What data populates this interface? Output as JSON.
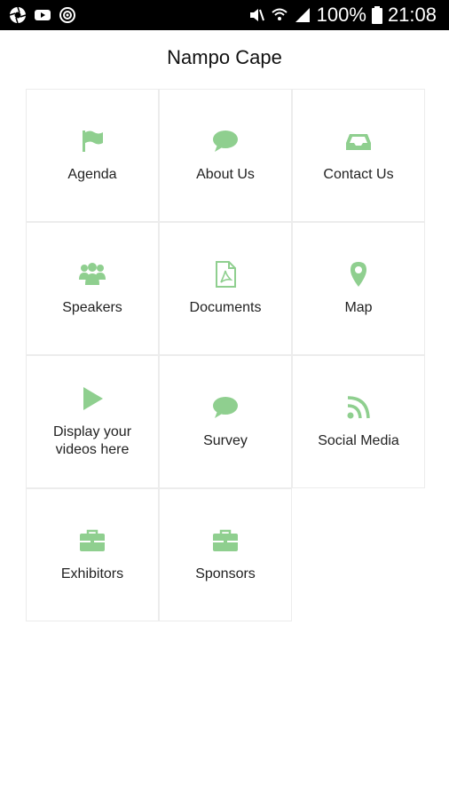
{
  "status_bar": {
    "battery": "100%",
    "time": "21:08",
    "left_icons": [
      "aperture-icon",
      "youtube-icon",
      "target-icon"
    ],
    "right_icons": [
      "mute-icon",
      "wifi-icon",
      "signal-icon",
      "battery-icon"
    ]
  },
  "header": {
    "title": "Nampo Cape"
  },
  "menu": {
    "accent_color": "#8fcf8f",
    "items": [
      {
        "label": "Agenda",
        "icon": "flag-icon"
      },
      {
        "label": "About Us",
        "icon": "chat-bubble-icon"
      },
      {
        "label": "Contact Us",
        "icon": "inbox-icon"
      },
      {
        "label": "Speakers",
        "icon": "users-icon"
      },
      {
        "label": "Documents",
        "icon": "pdf-document-icon"
      },
      {
        "label": "Map",
        "icon": "map-pin-icon"
      },
      {
        "label": "Display your videos here",
        "icon": "play-icon"
      },
      {
        "label": "Survey",
        "icon": "chat-bubble-icon"
      },
      {
        "label": "Social Media",
        "icon": "rss-icon"
      },
      {
        "label": "Exhibitors",
        "icon": "briefcase-icon"
      },
      {
        "label": "Sponsors",
        "icon": "briefcase-icon"
      }
    ]
  }
}
